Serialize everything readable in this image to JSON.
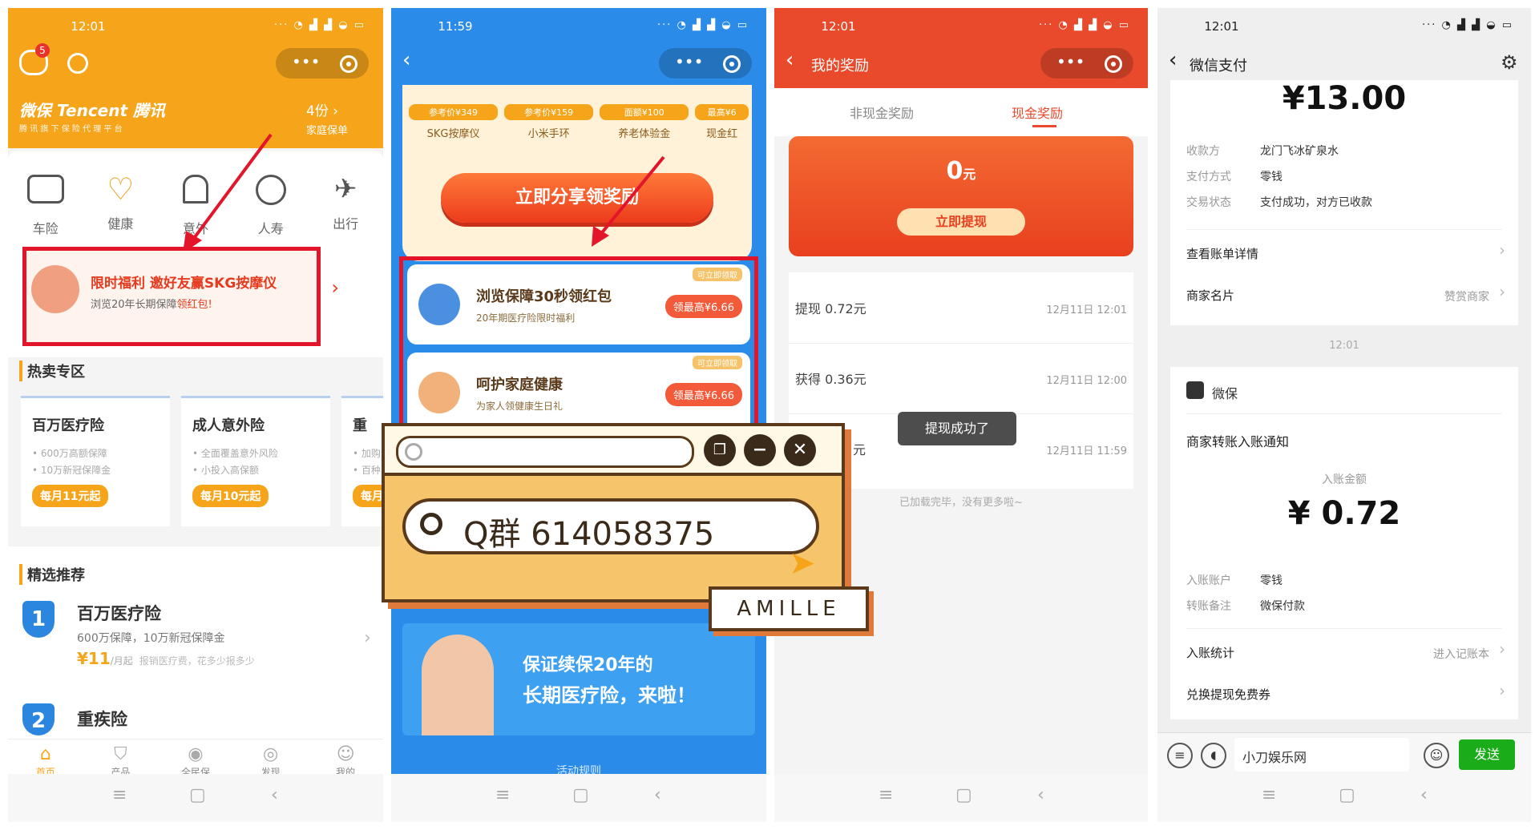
{
  "colors": {
    "orange": "#f6a51b",
    "blue": "#2b8be8",
    "red": "#ea4a2c",
    "wechat_green": "#1aad19",
    "highlight": "#e3152b"
  },
  "sys_nav_icons": [
    "menu-icon",
    "square-icon",
    "back-icon"
  ],
  "p1": {
    "status_time": "12:01",
    "logo": "微保 Tencent 腾讯",
    "logo_sub": "腾 讯 旗 下 保 险 代 理 平 台",
    "msg_badge": "5",
    "family_count": "4份 ›",
    "family_label": "家庭保单",
    "categories": [
      {
        "label": "车险",
        "icon": "car-icon"
      },
      {
        "label": "健康",
        "icon": "heart-icon"
      },
      {
        "label": "意外",
        "icon": "alarm-icon"
      },
      {
        "label": "人寿",
        "icon": "life-icon"
      },
      {
        "label": "出行",
        "icon": "plane-icon"
      }
    ],
    "banner_title": "限时福利 邀好友赢SKG按摩仪",
    "banner_sub_a": "浏览20年长期保障",
    "banner_sub_b": "领红包!",
    "hot_title": "热卖专区",
    "hot_cards": [
      {
        "title": "百万医疗险",
        "l1": "• 600万高额保障",
        "l2": "• 10万新冠保障金",
        "price": "每月11元起"
      },
      {
        "title": "成人意外险",
        "l1": "• 全面覆盖意外风险",
        "l2": "• 小投入高保额",
        "price": "每月10元起"
      },
      {
        "title": "重",
        "l1": "• 加购",
        "l2": "• 百种",
        "price": "每月"
      }
    ],
    "rec_title": "精选推荐",
    "rec1": {
      "rank": "1",
      "title": "百万医疗险",
      "desc": "600万保障，10万新冠保障金",
      "price": "¥11",
      "unit": "/月起",
      "note": "报销医疗费，花多少报多少"
    },
    "rec2": {
      "rank": "2",
      "title": "重疾险"
    },
    "tabs": [
      {
        "label": "首页",
        "icon": "home-icon"
      },
      {
        "label": "产品",
        "icon": "shield-icon"
      },
      {
        "label": "全民保",
        "icon": "location-icon"
      },
      {
        "label": "发现",
        "icon": "compass-icon"
      },
      {
        "label": "我的",
        "icon": "smile-icon"
      }
    ]
  },
  "p2": {
    "status_time": "11:59",
    "prizes": [
      {
        "tag": "参考价¥349",
        "name": "SKG按摩仪"
      },
      {
        "tag": "参考价¥159",
        "name": "小米手环"
      },
      {
        "tag": "面额¥100",
        "name": "养老体验金"
      },
      {
        "tag": "最高¥6",
        "name": "现金红"
      }
    ],
    "share_btn": "立即分享领奖励",
    "tasks": [
      {
        "title": "浏览保障30秒领红包",
        "sub": "20年期医疗险限时福利",
        "badge": "可立即领取",
        "btn": "领最高¥6.66"
      },
      {
        "title": "呵护家庭健康",
        "sub": "为家人领健康生日礼",
        "badge": "可立即领取",
        "btn": "领最高¥6.66"
      }
    ],
    "ad_line1": "保证续保20年的",
    "ad_line2": "长期医疗险，来啦！",
    "rules": "活动规则"
  },
  "p3": {
    "status_time": "12:01",
    "title": "我的奖励",
    "tab_noncash": "非现金奖励",
    "tab_cash": "现金奖励",
    "balance": "0",
    "balance_unit": "元",
    "withdraw_btn": "立即提现",
    "records": [
      {
        "label": "提现 0.72元",
        "time": "12月11日 12:01"
      },
      {
        "label": "获得 0.36元",
        "time": "12月11日 12:00"
      },
      {
        "label": "元",
        "time": "12月11日 11:59"
      }
    ],
    "toast": "提现成功了",
    "footer": "已加载完毕，没有更多啦~"
  },
  "p4": {
    "status_time": "12:01",
    "title": "微信支付",
    "amount": "¥13.00",
    "rows": [
      {
        "k": "收款方",
        "v": "龙门飞冰矿泉水"
      },
      {
        "k": "支付方式",
        "v": "零钱"
      },
      {
        "k": "交易状态",
        "v": "支付成功，对方已收款"
      }
    ],
    "bill_detail": "查看账单详情",
    "merchant_card": "商家名片",
    "merchant_link": "赞赏商家",
    "timestamp": "12:01",
    "sender": "微保",
    "notice_title": "商家转账入账通知",
    "income_label": "入账金额",
    "income_amount": "¥ 0.72",
    "rows2": [
      {
        "k": "入账账户",
        "v": "零钱"
      },
      {
        "k": "转账备注",
        "v": "微保付款"
      }
    ],
    "stats": "入账统计",
    "stats_link": "进入记账本",
    "exchange": "兑换提现免费券",
    "input_value": "小刀娱乐网",
    "send": "发送"
  },
  "overlay": {
    "search_text": "Q群  614058375",
    "brand": "AMILLE"
  }
}
